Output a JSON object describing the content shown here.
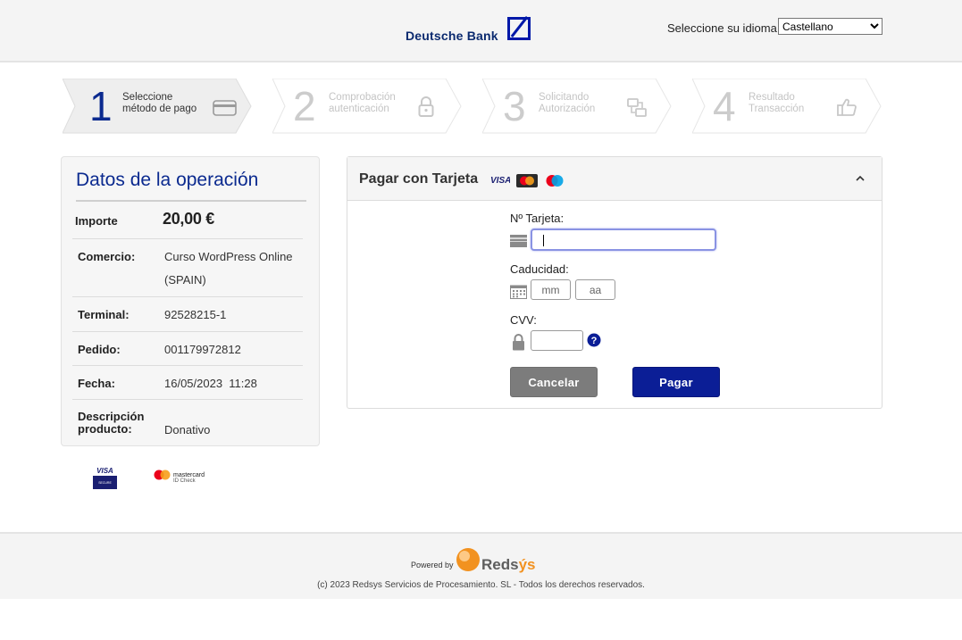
{
  "header": {
    "bank_name": "Deutsche Bank",
    "language_label": "Seleccione su idioma",
    "language_selected": "Castellano"
  },
  "steps": [
    {
      "number": "1",
      "line1": "Seleccione",
      "line2": "método de pago",
      "icon": "credit-card-icon",
      "active": true
    },
    {
      "number": "2",
      "line1": "Comprobación",
      "line2": "autenticación",
      "icon": "lock-icon",
      "active": false
    },
    {
      "number": "3",
      "line1": "Solicitando",
      "line2": "Autorización",
      "icon": "transfer-icon",
      "active": false
    },
    {
      "number": "4",
      "line1": "Resultado",
      "line2": "Transacción",
      "icon": "thumbs-up-icon",
      "active": false
    }
  ],
  "operation": {
    "title": "Datos de la operación",
    "amount_label": "Importe",
    "amount_value": "20,00 €",
    "merchant_label": "Comercio:",
    "merchant_line1": "Curso WordPress Online",
    "merchant_line2": "(SPAIN)",
    "terminal_label": "Terminal:",
    "terminal_value": "92528215-1",
    "order_label": "Pedido:",
    "order_value": "001179972812",
    "date_label": "Fecha:",
    "date_value": "16/05/2023  11:28",
    "desc_label_line1": "Descripción",
    "desc_label_line2": "producto:",
    "desc_value": "Donativo"
  },
  "secure_logos": {
    "visa_line1": "VISA",
    "visa_line2": "SECURE",
    "mc_line1": "mastercard",
    "mc_line2": "ID Check"
  },
  "card_form": {
    "title": "Pagar con Tarjeta",
    "visa_logo_text": "VISA",
    "card_number_label": "Nº Tarjeta:",
    "card_number_value": "",
    "expiry_label": "Caducidad:",
    "month_placeholder": "mm",
    "year_placeholder": "aa",
    "cvv_label": "CVV:",
    "cvv_help": "?",
    "cancel_label": "Cancelar",
    "pay_label": "Pagar"
  },
  "footer": {
    "powered_by": "Powered by",
    "brand_part1": "Reds",
    "brand_part2": "ýs",
    "copyright": "(c) 2023 Redsys Servicios de Procesamiento. SL - Todos los derechos reservados."
  },
  "colors": {
    "brand_blue": "#0b2a8f",
    "pay_button": "#0b1e96",
    "cancel_button": "#7c7c7c",
    "redsys_orange": "#f29220"
  }
}
